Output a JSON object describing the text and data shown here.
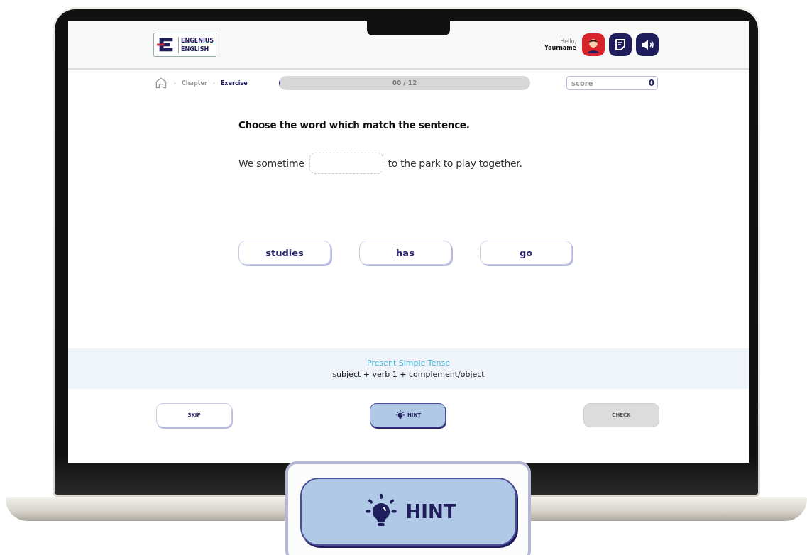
{
  "header": {
    "logo": {
      "line_1": "ENGENIUS",
      "line_2": "ENGLISH"
    },
    "greeting": "Hello,",
    "username": "Yourname"
  },
  "breadcrumb": [
    {
      "label": "Chapter",
      "selected": false
    },
    {
      "label": "Exercise",
      "selected": true
    }
  ],
  "progress": {
    "label": "00 / 12",
    "level": 0
  },
  "score": {
    "label": "score",
    "value": "0"
  },
  "question": "Choose the word which match the sentence.",
  "sentence": {
    "before": "We sometime",
    "after": "to the park to play together."
  },
  "options": [
    {
      "label": "studies",
      "selected": false
    },
    {
      "label": "has",
      "selected": false
    },
    {
      "label": "go",
      "selected": false
    }
  ],
  "grammar": {
    "title": "Present Simple Tense",
    "formula": "subject + verb 1 + complement/object"
  },
  "buttons": [
    {
      "label": "SKIP",
      "kind": "plain",
      "disabled": false
    },
    {
      "label": "HINT",
      "kind": "hint",
      "disabled": false
    },
    {
      "label": "CHECK",
      "kind": "plain",
      "disabled": true
    }
  ],
  "callout": {
    "label": "HINT",
    "kind": "hint"
  }
}
